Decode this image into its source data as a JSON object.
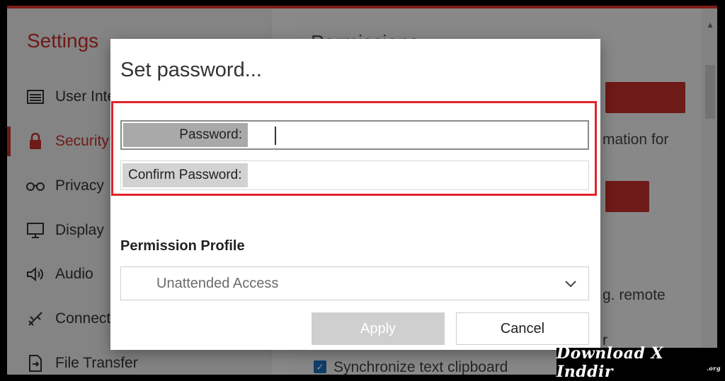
{
  "sidebar": {
    "title": "Settings",
    "items": [
      {
        "label": "User Inte",
        "icon": "user-interface-icon"
      },
      {
        "label": "Security",
        "icon": "lock-icon"
      },
      {
        "label": "Privacy",
        "icon": "glasses-icon"
      },
      {
        "label": "Display",
        "icon": "monitor-icon"
      },
      {
        "label": "Audio",
        "icon": "speaker-icon"
      },
      {
        "label": "Connecti",
        "icon": "connection-icon"
      },
      {
        "label": "File Transfer",
        "icon": "file-transfer-icon"
      }
    ],
    "active": "Security"
  },
  "content": {
    "title": "Permissions",
    "text_1": "mation for",
    "text_2": "g. remote",
    "text_3": "r",
    "checkbox_label": "Synchronize text clipboard"
  },
  "dialog": {
    "title": "Set password...",
    "password_label": "Password:",
    "password_value": "",
    "confirm_label": "Confirm Password:",
    "confirm_value": "",
    "section_label": "Permission Profile",
    "profile_value": "Unattended Access",
    "apply_label": "Apply",
    "cancel_label": "Cancel"
  },
  "watermark": {
    "text": "Download X Inddir",
    "suffix": ".org"
  },
  "colors": {
    "accent": "#c8312c",
    "highlight_border": "#e2232a",
    "checkbox": "#1e6fbf"
  }
}
